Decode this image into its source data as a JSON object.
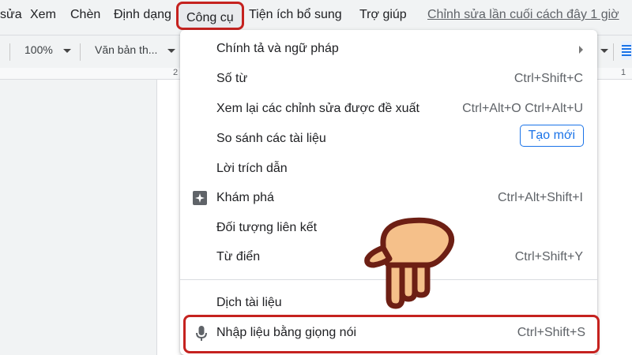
{
  "menubar": {
    "items": [
      "sửa",
      "Xem",
      "Chèn",
      "Định dạng",
      "Công cụ",
      "Tiện ích bổ sung",
      "Trợ giúp"
    ],
    "active_index": 4,
    "last_edit": "Chỉnh sửa lần cuối cách đây 1 giờ"
  },
  "toolbar": {
    "zoom": "100%",
    "style": "Văn bản th..."
  },
  "ruler": {
    "left_number": "2",
    "right_number": "1"
  },
  "tools_menu": {
    "items": [
      {
        "label": "Chính tả và ngữ pháp",
        "shortcut": "",
        "submenu": true
      },
      {
        "label": "Số từ",
        "shortcut": "Ctrl+Shift+C"
      },
      {
        "label": "Xem lại các chỉnh sửa được đề xuất",
        "shortcut": "Ctrl+Alt+O Ctrl+Alt+U"
      },
      {
        "label": "So sánh các tài liệu",
        "badge": "Tạo mới"
      },
      {
        "label": "Lời trích dẫn",
        "shortcut": ""
      },
      {
        "label": "Khám phá",
        "shortcut": "Ctrl+Alt+Shift+I",
        "icon": "explore-icon"
      },
      {
        "label": "Đối tượng liên kết",
        "shortcut": ""
      },
      {
        "label": "Từ điển",
        "shortcut": "Ctrl+Shift+Y"
      },
      {
        "label": "Dịch tài liệu",
        "shortcut": ""
      },
      {
        "label": "Nhập liệu bằng giọng nói",
        "shortcut": "Ctrl+Shift+S",
        "icon": "microphone-icon",
        "highlighted": true
      }
    ]
  },
  "colors": {
    "highlight_border": "#c5221f",
    "accent": "#1a73e8",
    "hand_fill": "#f5c08a",
    "hand_outline": "#6d1f14"
  }
}
